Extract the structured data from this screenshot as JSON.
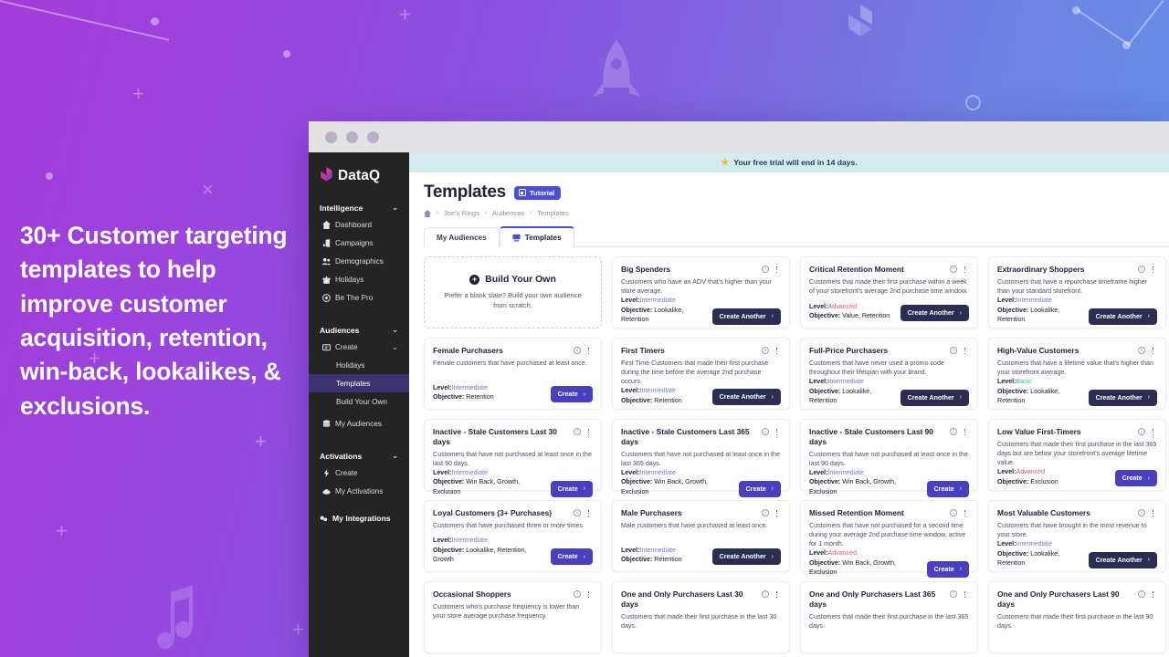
{
  "promo": {
    "text": "30+ Customer targeting templates to help improve customer acquisition, retention, win-back, lookalikes, & exclusions."
  },
  "sidebar": {
    "brand": "DataQ",
    "sections": [
      {
        "label": "Intelligence",
        "items": [
          {
            "label": "Dashboard",
            "icon": "home-icon"
          },
          {
            "label": "Campaigns",
            "icon": "megaphone-icon"
          },
          {
            "label": "Demographics",
            "icon": "people-icon"
          },
          {
            "label": "Holidays",
            "icon": "gift-icon"
          },
          {
            "label": "Be The Pro",
            "icon": "target-icon"
          }
        ]
      },
      {
        "label": "Audiences",
        "items": [
          {
            "label": "Create",
            "icon": "create-icon",
            "expandable": true
          },
          {
            "label": "Holidays",
            "sub": true
          },
          {
            "label": "Templates",
            "sub": true,
            "active": true
          },
          {
            "label": "Build Your Own",
            "sub": true
          },
          {
            "label": "My Audiences",
            "icon": "database-icon"
          }
        ]
      },
      {
        "label": "Activations",
        "items": [
          {
            "label": "Create",
            "icon": "bolt-icon"
          },
          {
            "label": "My Activations",
            "icon": "cloud-icon"
          }
        ]
      }
    ],
    "footer_item": {
      "label": "My Integrations",
      "icon": "integrations-icon"
    }
  },
  "banner": {
    "icon": "star-icon",
    "text": "Your free trial will end in 14 days."
  },
  "header": {
    "title": "Templates",
    "tutorial_label": "Tutorial",
    "breadcrumb": [
      "Joe's Rings",
      "Audiences",
      "Templates"
    ]
  },
  "tabs": [
    {
      "label": "My Audiences",
      "active": false
    },
    {
      "label": "Templates",
      "active": true
    }
  ],
  "build_your_own": {
    "title": "Build Your Own",
    "description": "Prefer a blank slate? Build your own audience from scratch."
  },
  "labels": {
    "level": "Level:",
    "objective": "Objective:",
    "arrow": "›"
  },
  "cards": [
    {
      "title": "Big Spenders",
      "description": "Customers who have an AOV that's higher than your store average.",
      "level": "Intermediate",
      "objective": "Lookalike, Retention",
      "button": "Create Another",
      "button_style": "dark"
    },
    {
      "title": "Critical Retention Moment",
      "description": "Customers that made their first purchase within a week of your storefront's average 2nd purchase time window.",
      "level": "Advanced",
      "objective": "Value, Retention",
      "button": "Create Another",
      "button_style": "dark"
    },
    {
      "title": "Extraordinary Shoppers",
      "description": "Customers that have a repurchase timeframe higher than your standard storefront.",
      "level": "Intermediate",
      "objective": "Lookalike, Retention",
      "button": "Create Another",
      "button_style": "dark"
    },
    {
      "title": "Female Purchasers",
      "description": "Female customers that have purchased at least once.",
      "level": "Intermediate",
      "objective": "Retention",
      "button": "Create",
      "button_style": "purple"
    },
    {
      "title": "First Timers",
      "description": "First Time Customers that made their first purchase during the time before the average 2nd purchase occurs.",
      "level": "Intermediate",
      "objective": "Retention",
      "button": "Create Another",
      "button_style": "dark"
    },
    {
      "title": "Full-Price Purchasers",
      "description": "Customers that have never used a promo code throughout their lifespan with your brand.",
      "level": "Intermediate",
      "objective": "Lookalike, Retention",
      "button": "Create Another",
      "button_style": "dark"
    },
    {
      "title": "High-Value Customers",
      "description": "Customers that have a lifetime value that's higher than your storefront average.",
      "level": "Basic",
      "objective": "Lookalike, Retention",
      "button": "Create Another",
      "button_style": "dark"
    },
    {
      "title": "Inactive - Stale Customers Last 30 days",
      "description": "Customers that have not purchased at least once in the last 90 days.",
      "level": "Intermediate",
      "objective": "Win Back, Growth, Exclusion",
      "button": "Create",
      "button_style": "purple"
    },
    {
      "title": "Inactive - Stale Customers Last 365 days",
      "description": "Customers that have not purchased at least once in the last 365 days.",
      "level": "Intermediate",
      "objective": "Win Back, Growth, Exclusion",
      "button": "Create",
      "button_style": "purple"
    },
    {
      "title": "Inactive - Stale Customers Last 90 days",
      "description": "Customers that have not purchased at least once in the last 90 days.",
      "level": "Intermediate",
      "objective": "Win Back, Growth, Exclusion",
      "button": "Create",
      "button_style": "purple"
    },
    {
      "title": "Low Value First-Timers",
      "description": "Customers that made their first purchase in the last 365 days but are below your storefront's average lifetime value.",
      "level": "Advanced",
      "objective": "Exclusion",
      "button": "Create",
      "button_style": "purple"
    },
    {
      "title": "Loyal Customers (3+ Purchases)",
      "description": "Customers that have purchased three or more times.",
      "level": "Intermediate",
      "objective": "Lookalike, Retention, Growth",
      "button": "Create",
      "button_style": "purple"
    },
    {
      "title": "Male Purchasers",
      "description": "Male customers that have purchased at least once.",
      "level": "Intermediate",
      "objective": "Retention",
      "button": "Create Another",
      "button_style": "dark"
    },
    {
      "title": "Missed Retention Moment",
      "description": "Customers that have not purchased for a second time during your average 2nd purchase time window, active for 1 month.",
      "level": "Advanced",
      "objective": "Win Back, Growth, Exclusion",
      "button": "Create",
      "button_style": "purple"
    },
    {
      "title": "Most Valuable Customers",
      "description": "Customers that have brought in the most revenue to your store.",
      "level": "Intermediate",
      "objective": "Lookalike, Retention",
      "button": "Create Another",
      "button_style": "dark"
    },
    {
      "title": "Occasional Shoppers",
      "description": "Customers who's purchase frequency is lower than your store average purchase frequency.",
      "level": "",
      "objective": "",
      "button": "",
      "button_style": ""
    },
    {
      "title": "One and Only Purchasers Last 30 days",
      "description": "Customers that made their first purchase in the last 30 days.",
      "level": "",
      "objective": "",
      "button": "",
      "button_style": ""
    },
    {
      "title": "One and Only Purchasers Last 365 days",
      "description": "Customers that made their first purchase in the last 365 days.",
      "level": "",
      "objective": "",
      "button": "",
      "button_style": ""
    },
    {
      "title": "One and Only Purchasers Last 90 days",
      "description": "Customers that made their first purchase in the last 90 days.",
      "level": "",
      "objective": "",
      "button": "",
      "button_style": ""
    }
  ],
  "colors": {
    "accent_purple": "#4a4ed4",
    "btn_dark": "#2b2e52",
    "btn_purple": "#4a3fbf",
    "sidebar_bg": "#242424",
    "active_nav": "#3b3470",
    "banner_bg": "#d2ecf0",
    "level_intermediate": "#6f7ad8",
    "level_advanced": "#e2556a",
    "level_basic": "#3fb8b0"
  }
}
